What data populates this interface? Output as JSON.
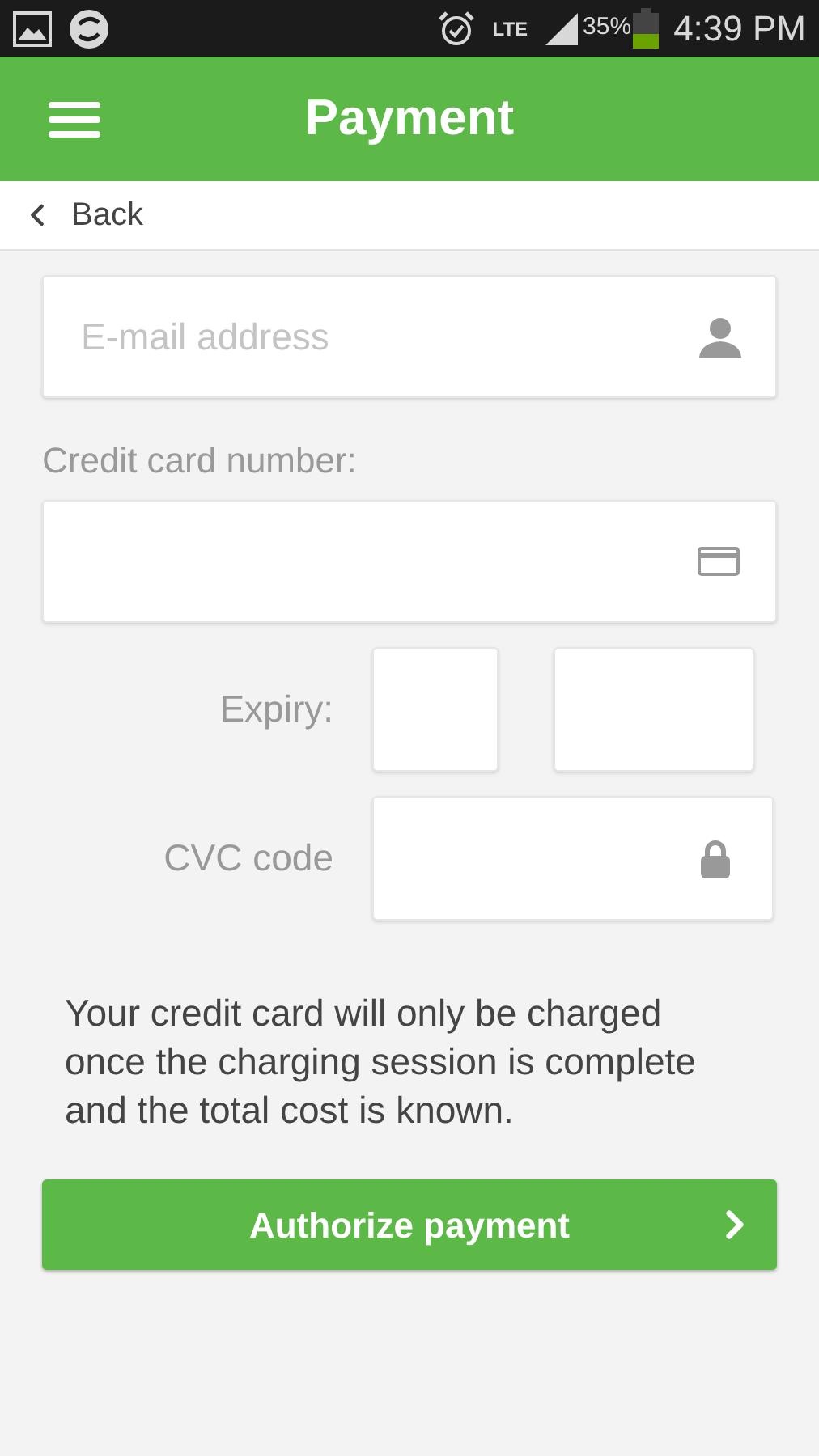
{
  "status_bar": {
    "network": "LTE",
    "battery": "35%",
    "time": "4:39 PM"
  },
  "app_bar": {
    "title": "Payment"
  },
  "nav": {
    "back": "Back"
  },
  "form": {
    "email": {
      "placeholder": "E-mail address"
    },
    "card_label": "Credit card number:",
    "expiry_label": "Expiry:",
    "cvc_label": "CVC code"
  },
  "note": "Your credit card will only be charged once the charging session is complete and the total cost is known.",
  "button": {
    "label": "Authorize payment"
  }
}
